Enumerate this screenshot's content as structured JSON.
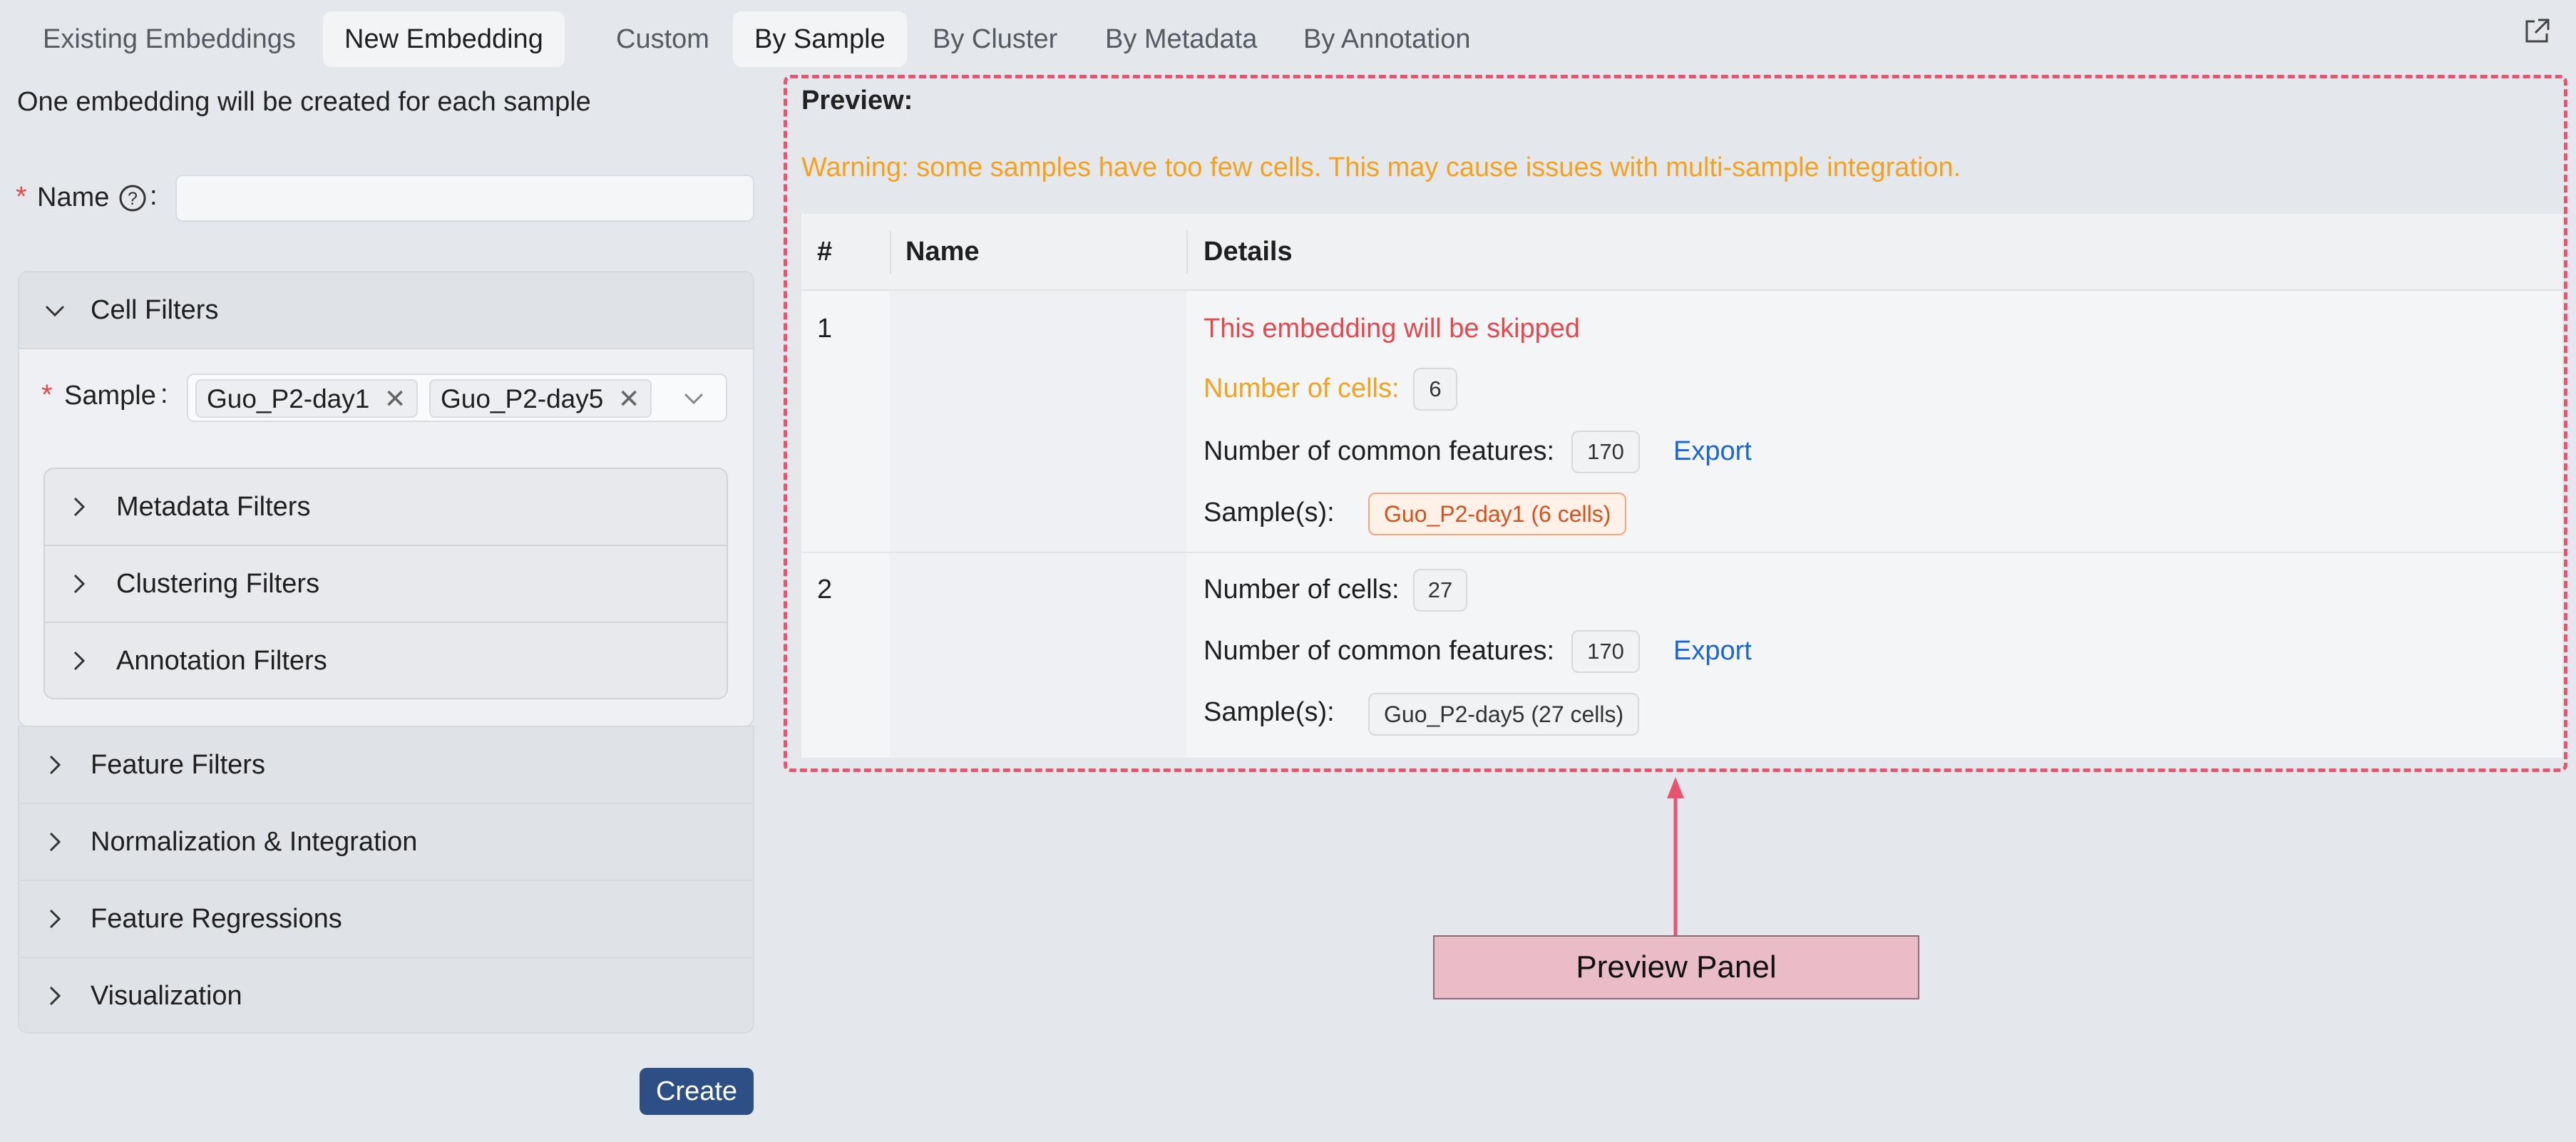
{
  "tabs": {
    "mode": [
      "Existing Embeddings",
      "New Embedding"
    ],
    "by": [
      "Custom",
      "By Sample",
      "By Cluster",
      "By Metadata",
      "By Annotation"
    ]
  },
  "left": {
    "description": "One embedding will be created for each sample",
    "name_label": "Name",
    "name_value": "",
    "cell_filters": "Cell Filters",
    "sample_label": "Sample",
    "sample_tags": [
      "Guo_P2-day1",
      "Guo_P2-day5"
    ],
    "sub_filters": [
      "Metadata Filters",
      "Clustering Filters",
      "Annotation Filters"
    ],
    "sections": [
      "Feature Filters",
      "Normalization & Integration",
      "Feature Regressions",
      "Visualization"
    ],
    "create_button": "Create"
  },
  "preview": {
    "title": "Preview:",
    "warning": "Warning: some samples have too few cells. This may cause issues with multi-sample integration.",
    "columns": [
      "#",
      "Name",
      "Details"
    ],
    "rows": [
      {
        "index": "1",
        "name": "",
        "skipped": "This embedding will be skipped",
        "cells_label": "Number of cells:",
        "cells": "6",
        "features_label": "Number of common features:",
        "features": "170",
        "export": "Export",
        "samples_label": "Sample(s):",
        "sample": "Guo_P2-day1 (6 cells)"
      },
      {
        "index": "2",
        "name": "",
        "cells_label": "Number of cells:",
        "cells": "27",
        "features_label": "Number of common features:",
        "features": "170",
        "export": "Export",
        "samples_label": "Sample(s):",
        "sample": "Guo_P2-day5 (27 cells)"
      }
    ]
  },
  "annotation": {
    "label": "Preview Panel"
  },
  "colors": {
    "accent": "#1a66d6",
    "warning": "#f4a21e",
    "danger": "#e5484d",
    "highlight_border": "#e8546f",
    "callout_fill": "#e9bcc8",
    "button": "#2e4f86"
  },
  "icons": [
    "help-circle-icon",
    "close-icon",
    "chevron-down-icon",
    "chevron-right-icon",
    "external-link-icon",
    "arrow-up-icon"
  ]
}
